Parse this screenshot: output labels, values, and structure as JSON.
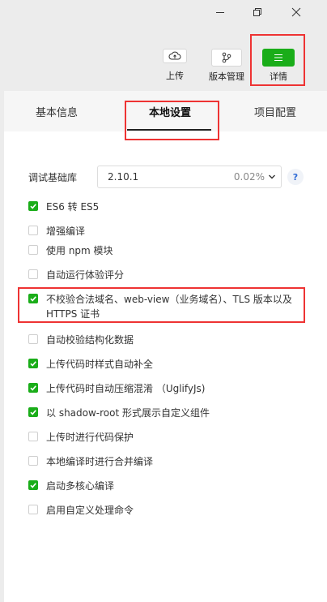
{
  "window": {
    "minimize_icon": "minimize-icon",
    "restore_icon": "restore-icon",
    "close_icon": "close-icon"
  },
  "toolbar": {
    "upload_label": "上传",
    "version_label": "版本管理",
    "details_label": "详情",
    "accent_color": "#1aad19",
    "highlight_color": "#e33333"
  },
  "tabs": [
    {
      "label": "基本信息",
      "active": false
    },
    {
      "label": "本地设置",
      "active": true
    },
    {
      "label": "项目配置",
      "active": false
    }
  ],
  "debug_lib": {
    "label": "调试基础库",
    "version": "2.10.1",
    "percent": "0.02%",
    "help": "?"
  },
  "options": [
    {
      "label": "ES6 转 ES5",
      "checked": true
    },
    {
      "label": "增强编译",
      "checked": false
    },
    {
      "label": "使用 npm 模块",
      "checked": false
    },
    {
      "label": "自动运行体验评分",
      "checked": false
    },
    {
      "label": "不校验合法域名、web-view（业务域名）、TLS 版本以及 HTTPS 证书",
      "checked": true
    },
    {
      "label": "自动校验结构化数据",
      "checked": false
    },
    {
      "label": "上传代码时样式自动补全",
      "checked": true
    },
    {
      "label": "上传代码时自动压缩混淆 （UglifyJs)",
      "checked": true
    },
    {
      "label": "以 shadow-root 形式展示自定义组件",
      "checked": true
    },
    {
      "label": "上传时进行代码保护",
      "checked": false
    },
    {
      "label": "本地编译时进行合并编译",
      "checked": false
    },
    {
      "label": "启动多核心编译",
      "checked": true
    },
    {
      "label": "启用自定义处理命令",
      "checked": false
    }
  ]
}
